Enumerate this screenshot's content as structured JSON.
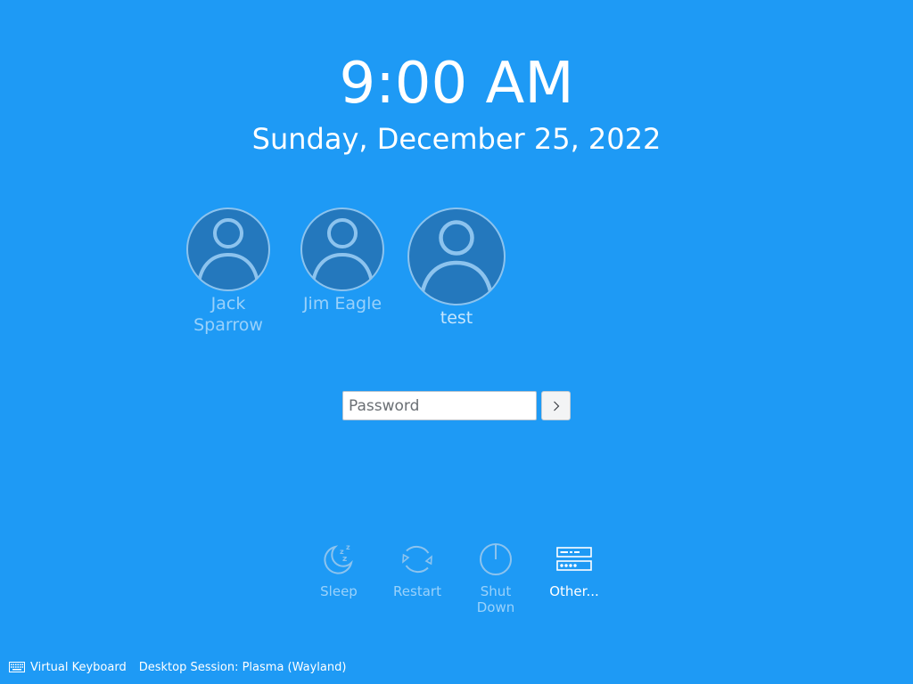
{
  "clock": {
    "time": "9:00 AM",
    "date": "Sunday, December 25, 2022"
  },
  "users": [
    {
      "name": "Jack Sparrow",
      "icon": "user-avatar-icon",
      "selected": false
    },
    {
      "name": "Jim Eagle",
      "icon": "user-avatar-icon",
      "selected": false
    },
    {
      "name": "test",
      "icon": "user-avatar-icon",
      "selected": true
    }
  ],
  "login": {
    "password_placeholder": "Password",
    "password_value": "",
    "submit_icon": "chevron-right-icon"
  },
  "actions": [
    {
      "label": "Sleep",
      "icon": "sleep-moon-icon"
    },
    {
      "label": "Restart",
      "icon": "restart-icon"
    },
    {
      "label": "Shut Down",
      "icon": "power-icon"
    },
    {
      "label": "Other...",
      "icon": "other-users-icon"
    }
  ],
  "footer": {
    "virtual_keyboard": "Virtual Keyboard",
    "session": "Desktop Session: Plasma (Wayland)"
  },
  "colors": {
    "background": "#1e9af5",
    "avatar_fill": "#2478bd",
    "avatar_stroke": "#8cc3ee",
    "text": "#ffffff"
  }
}
